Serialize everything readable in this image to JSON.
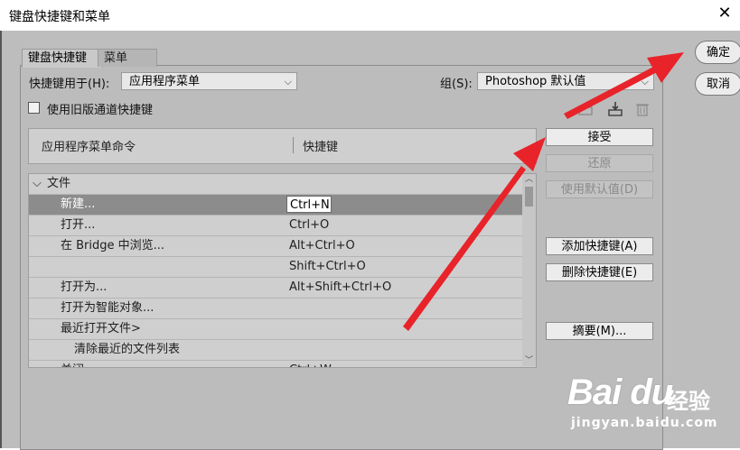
{
  "window": {
    "title": "键盘快捷键和菜单"
  },
  "tabs": [
    {
      "label": "键盘快捷键"
    },
    {
      "label": "菜单"
    }
  ],
  "shortcuts_for": {
    "label": "快捷键用于(H):",
    "value": "应用程序菜单"
  },
  "group": {
    "label": "组(S):",
    "value": "Photoshop 默认值"
  },
  "legacy_channel": {
    "label": "使用旧版通道快捷键",
    "checked": false
  },
  "columns": {
    "command": "应用程序菜单命令",
    "shortcut": "快捷键"
  },
  "rows": [
    {
      "command": "文件",
      "shortcut": "",
      "indent": 0,
      "expander": "⌵"
    },
    {
      "command": "新建...",
      "shortcut": "Ctrl+N",
      "indent": 1,
      "selected": true
    },
    {
      "command": "打开...",
      "shortcut": "Ctrl+O",
      "indent": 1
    },
    {
      "command": "在 Bridge 中浏览...",
      "shortcut": "Alt+Ctrl+O",
      "indent": 1
    },
    {
      "command": "",
      "shortcut": "Shift+Ctrl+O",
      "indent": 1
    },
    {
      "command": "打开为...",
      "shortcut": "Alt+Shift+Ctrl+O",
      "indent": 1
    },
    {
      "command": "打开为智能对象...",
      "shortcut": "",
      "indent": 1
    },
    {
      "command": "最近打开文件>",
      "shortcut": "",
      "indent": 1
    },
    {
      "command": "清除最近的文件列表",
      "shortcut": "",
      "indent": 2
    },
    {
      "command": "关闭",
      "shortcut": "Ctrl+W",
      "indent": 1
    }
  ],
  "buttons": {
    "accept": "接受",
    "undo": "还原",
    "use_default": "使用默认值(D)",
    "add_shortcut": "添加快捷键(A)",
    "delete_shortcut": "删除快捷键(E)",
    "summary": "摘要(M)...",
    "ok": "确定",
    "cancel": "取消"
  },
  "watermark": {
    "logo": "Bai du",
    "cn": "经验",
    "url": "jingyan.baidu.com"
  },
  "colors": {
    "annotation_arrow": "#e8232a",
    "dialog_bg": "#bdbdbd",
    "selected_row": "#8c8c8c"
  }
}
